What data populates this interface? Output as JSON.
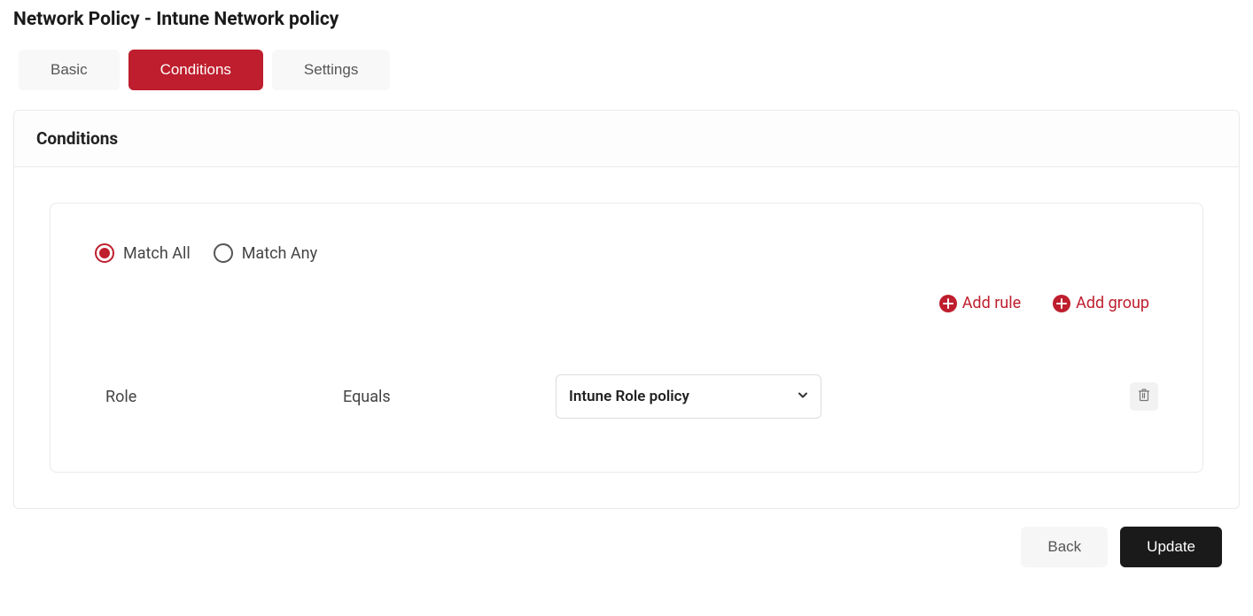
{
  "page": {
    "title": "Network Policy - Intune Network policy"
  },
  "tabs": {
    "basic": "Basic",
    "conditions": "Conditions",
    "settings": "Settings"
  },
  "panel": {
    "header": "Conditions"
  },
  "match": {
    "all": "Match All",
    "any": "Match Any"
  },
  "actions": {
    "add_rule": "Add rule",
    "add_group": "Add group"
  },
  "rule": {
    "field": "Role",
    "operator": "Equals",
    "value": "Intune Role policy"
  },
  "footer": {
    "back": "Back",
    "update": "Update"
  }
}
